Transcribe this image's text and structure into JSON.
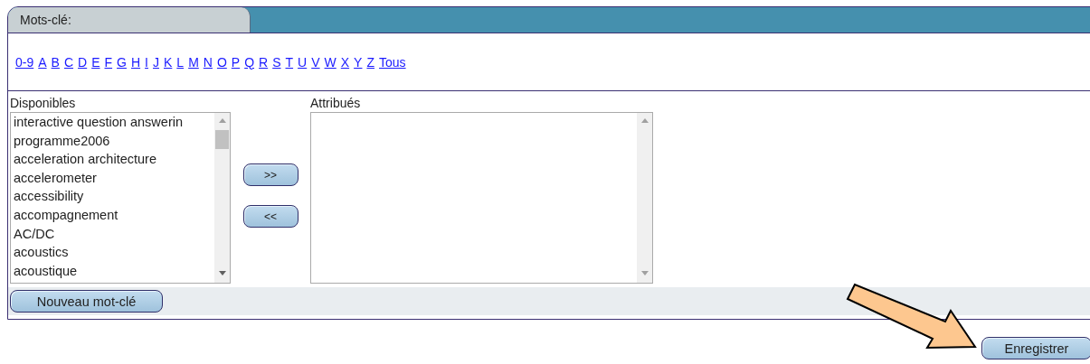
{
  "tab": {
    "label": "Mots-clé:"
  },
  "letters": [
    "0-9",
    "A",
    "B",
    "C",
    "D",
    "E",
    "F",
    "G",
    "H",
    "I",
    "J",
    "K",
    "L",
    "M",
    "N",
    "O",
    "P",
    "Q",
    "R",
    "S",
    "T",
    "U",
    "V",
    "W",
    "X",
    "Y",
    "Z",
    "Tous"
  ],
  "available": {
    "label": "Disponibles",
    "items": [
      "interactive question answerin",
      "programme2006",
      "acceleration architecture",
      "accelerometer",
      "accessibility",
      "accompagnement",
      "AC/DC",
      "acoustics",
      "acoustique"
    ]
  },
  "move_buttons": [
    ">>",
    "<<"
  ],
  "assigned": {
    "label": "Attribués"
  },
  "new_button": "Nouveau mot-clé",
  "save_button": "Enregistrer"
}
